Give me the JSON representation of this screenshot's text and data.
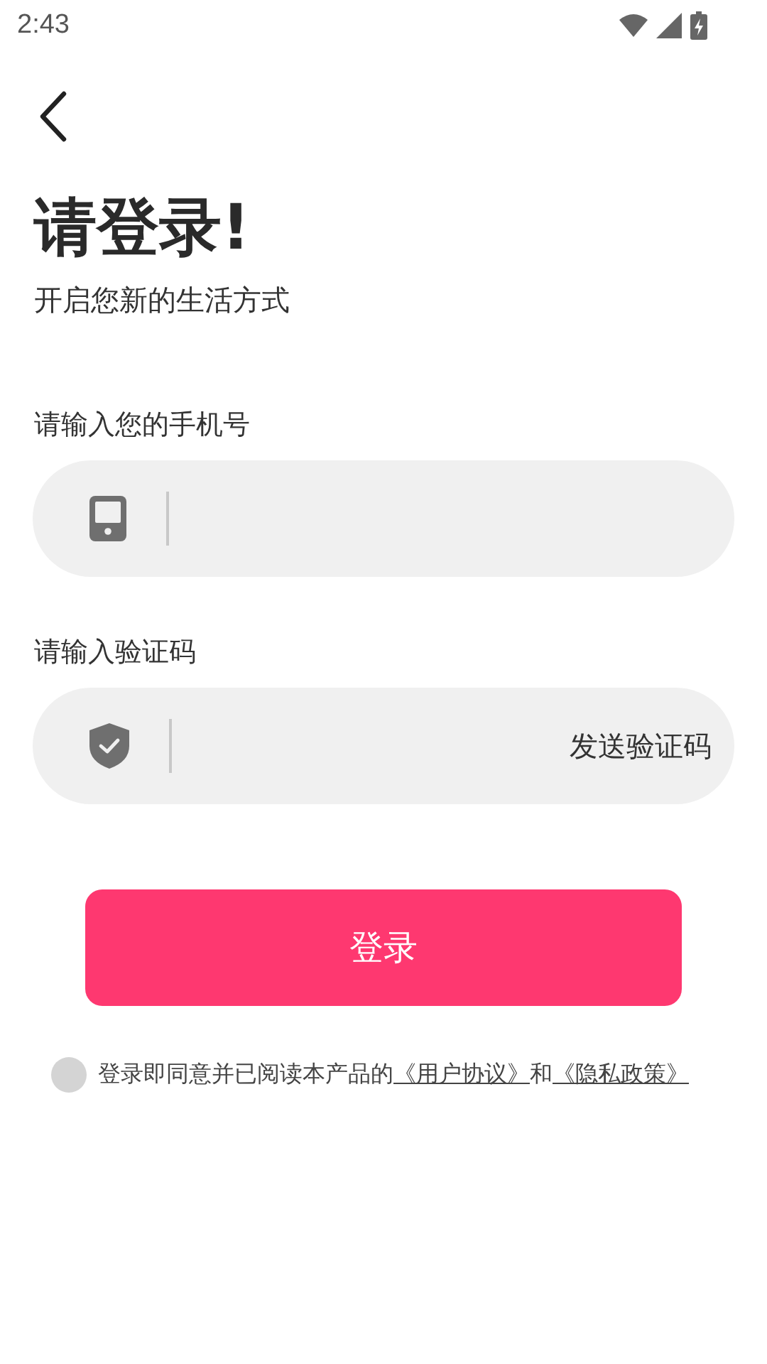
{
  "status_bar": {
    "time": "2:43"
  },
  "title": "请登录!",
  "subtitle": "开启您新的生活方式",
  "phone": {
    "label": "请输入您的手机号"
  },
  "code": {
    "label": "请输入验证码",
    "send_button": "发送验证码"
  },
  "login_button": "登录",
  "agreement": {
    "checked": false,
    "text": "登录即同意并已阅读本产品的",
    "link_1": "《用户协议》",
    "joiner": "和",
    "link_2": "《隐私政策》"
  }
}
